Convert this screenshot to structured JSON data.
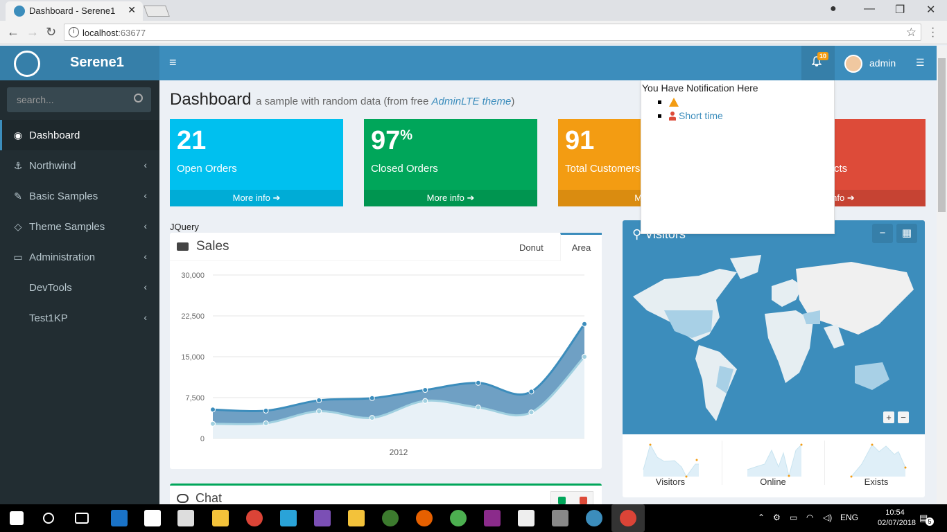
{
  "browser": {
    "tab_title": "Dashboard - Serene1",
    "url_host": "localhost",
    "url_port": ":63677"
  },
  "app": {
    "name": "Serene1",
    "notification_count": "10",
    "username": "admin"
  },
  "sidebar": {
    "search_placeholder": "search...",
    "items": [
      {
        "label": "Dashboard",
        "icon": "dashboard-icon"
      },
      {
        "label": "Northwind",
        "icon": "anchor-icon"
      },
      {
        "label": "Basic Samples",
        "icon": "magic-icon"
      },
      {
        "label": "Theme Samples",
        "icon": "diamond-icon"
      },
      {
        "label": "Administration",
        "icon": "desktop-icon"
      },
      {
        "label": "DevTools",
        "icon": ""
      },
      {
        "label": "Test1KP",
        "icon": ""
      }
    ]
  },
  "page": {
    "title": "Dashboard",
    "subtitle_pre": "a sample with random data (from free ",
    "subtitle_link": "AdminLTE theme",
    "subtitle_post": ")"
  },
  "stats": [
    {
      "value": "21",
      "suffix": "",
      "label": "Open Orders",
      "footer": "More info",
      "color": "#00c0ef"
    },
    {
      "value": "97",
      "suffix": "%",
      "label": "Closed Orders",
      "footer": "More info",
      "color": "#00a65a"
    },
    {
      "value": "91",
      "suffix": "",
      "label": "Total Customers",
      "footer": "More",
      "color": "#f39c12"
    },
    {
      "value": "",
      "suffix": "",
      "label": "cts",
      "footer": "info",
      "color": "#dd4b39"
    }
  ],
  "jquery_label": "JQuery",
  "sales": {
    "title": "Sales",
    "tabs": [
      "Donut",
      "Area"
    ],
    "active_tab": "Area"
  },
  "chart_data": {
    "type": "area",
    "x": [
      1,
      2,
      3,
      4,
      5,
      6,
      7,
      8
    ],
    "xlabel": "2012",
    "ylim": [
      0,
      30000
    ],
    "yticks": [
      "30,000",
      "22,500",
      "15,000",
      "7,500",
      "0"
    ],
    "series": [
      {
        "name": "",
        "color": "#3c8dbc",
        "values": [
          5300,
          5100,
          7000,
          7400,
          8900,
          10200,
          8600,
          21000
        ]
      },
      {
        "name": "",
        "color": "#a0d0e0",
        "values": [
          2700,
          2800,
          5000,
          3800,
          6900,
          5700,
          4800,
          15000
        ]
      }
    ]
  },
  "chat": {
    "title": "Chat"
  },
  "visitors": {
    "title": "Visitors",
    "sparklines": [
      "Visitors",
      "Online",
      "Exists"
    ]
  },
  "notification": {
    "header": "You Have Notification Here",
    "item2": "Short time"
  },
  "taskbar": {
    "lang": "ENG",
    "time": "10:54",
    "date": "02/07/2018",
    "notif_count": "5"
  }
}
